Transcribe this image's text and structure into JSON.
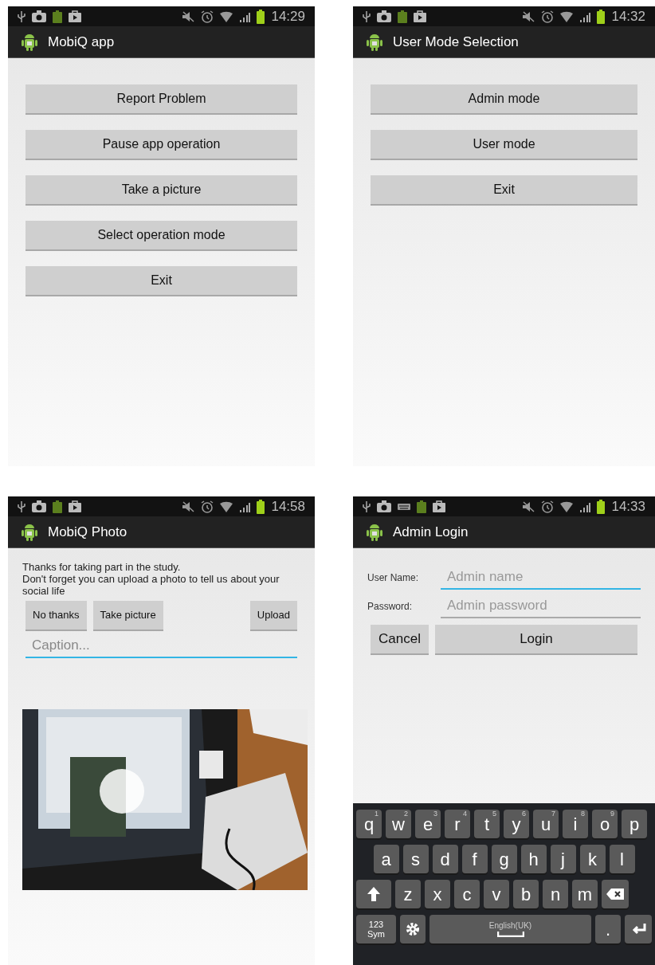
{
  "screens": [
    {
      "kind": "menu",
      "time": "14:29",
      "keyboard_notice": false,
      "title": "MobiQ app",
      "buttons": [
        "Report Problem",
        "Pause app operation",
        "Take a picture",
        "Select operation mode",
        "Exit"
      ]
    },
    {
      "kind": "menu",
      "time": "14:32",
      "keyboard_notice": false,
      "title": "User Mode Selection",
      "buttons": [
        "Admin mode",
        "User mode",
        "Exit"
      ]
    },
    {
      "time": "14:58",
      "keyboard_notice": false,
      "title": "MobiQ Photo",
      "message": [
        "Thanks for taking part in the study.",
        "Don't forget you can upload a photo to tell us about your social life"
      ],
      "buttons": [
        "No thanks",
        "Take picture",
        "Upload"
      ],
      "caption": {
        "placeholder": "Caption...",
        "focused": true
      },
      "photo": {
        "kind": "picture"
      }
    },
    {
      "kind": "login",
      "time": "14:33",
      "keyboard_notice": true,
      "title": "Admin Login",
      "fields": [
        {
          "label": "User Name:",
          "placeholder": "Admin name",
          "focused": true
        },
        {
          "label": "Password:",
          "placeholder": "Admin password",
          "focused": false
        }
      ],
      "buttons": [
        "Cancel",
        "Login"
      ],
      "keyboard": {
        "rows": [
          {
            "keys": [
              {
                "kind": "letter",
                "label": "q",
                "hint": "1"
              },
              {
                "kind": "letter",
                "label": "w",
                "hint": "2"
              },
              {
                "kind": "letter",
                "label": "e",
                "hint": "3"
              },
              {
                "kind": "letter",
                "label": "r",
                "hint": "4"
              },
              {
                "kind": "letter",
                "label": "t",
                "hint": "5"
              },
              {
                "kind": "letter",
                "label": "y",
                "hint": "6"
              },
              {
                "kind": "letter",
                "label": "u",
                "hint": "7"
              },
              {
                "kind": "letter",
                "label": "i",
                "hint": "8"
              },
              {
                "kind": "letter",
                "label": "o",
                "hint": "9"
              },
              {
                "kind": "letter",
                "label": "p"
              }
            ]
          },
          {
            "keys": [
              {
                "kind": "letter",
                "label": "a"
              },
              {
                "kind": "letter",
                "label": "s"
              },
              {
                "kind": "letter",
                "label": "d"
              },
              {
                "kind": "letter",
                "label": "f"
              },
              {
                "kind": "letter",
                "label": "g"
              },
              {
                "kind": "letter",
                "label": "h"
              },
              {
                "kind": "letter",
                "label": "j"
              },
              {
                "kind": "letter",
                "label": "k"
              },
              {
                "kind": "letter",
                "label": "l"
              }
            ]
          },
          {
            "keys": [
              {
                "kind": "shift"
              },
              {
                "kind": "letter",
                "label": "z"
              },
              {
                "kind": "letter",
                "label": "x"
              },
              {
                "kind": "letter",
                "label": "c"
              },
              {
                "kind": "letter",
                "label": "v"
              },
              {
                "kind": "letter",
                "label": "b"
              },
              {
                "kind": "letter",
                "label": "n"
              },
              {
                "kind": "letter",
                "label": "m"
              },
              {
                "kind": "backspace"
              }
            ]
          },
          {
            "keys": [
              {
                "kind": "sym",
                "lines": [
                  "123",
                  "Sym"
                ]
              },
              {
                "kind": "settings"
              },
              {
                "kind": "space",
                "label": "English(UK)"
              },
              {
                "kind": "letter",
                "label": "."
              },
              {
                "kind": "enter"
              }
            ]
          }
        ]
      }
    }
  ]
}
